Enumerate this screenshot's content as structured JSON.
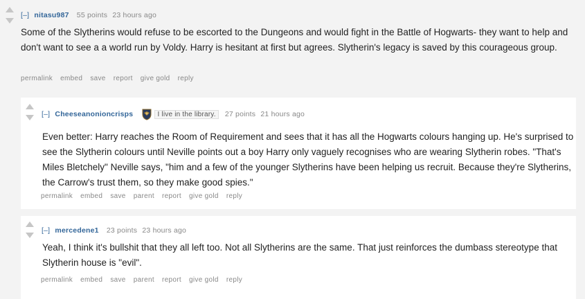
{
  "comments": [
    {
      "toggle": "[–]",
      "author": "nitasu987",
      "score": "55 points",
      "time": "23 hours ago",
      "body": "Some of the Slytherins would refuse to be escorted to the Dungeons and would fight in the Battle of Hogwarts- they want to help and don't want to see a a world run by Voldy. Harry is hesitant at first but agrees. Slytherin's legacy is saved by this courageous group.",
      "buttons": [
        "permalink",
        "embed",
        "save",
        "report",
        "give gold",
        "reply"
      ]
    },
    {
      "toggle": "[–]",
      "author": "Cheeseanonioncrisps",
      "flair_icon": "ravenclaw-crest-icon",
      "flair_text": "I live in the library.",
      "score": "27 points",
      "time": "21 hours ago",
      "body": "Even better: Harry reaches the Room of Requirement and sees that it has all the Hogwarts colours hanging up. He's surprised to see the Slytherin colours until Neville points out a boy Harry only vaguely recognises who are wearing Slytherin robes. \"That's Miles Bletchely\" Neville says, \"him and a few of the younger Slytherins have been helping us recruit. Because they're Slytherins, the Carrow's trust them, so they make good spies.\"",
      "buttons": [
        "permalink",
        "embed",
        "save",
        "parent",
        "report",
        "give gold",
        "reply"
      ]
    },
    {
      "toggle": "[–]",
      "author": "mercedene1",
      "score": "23 points",
      "time": "23 hours ago",
      "body": "Yeah, I think it's bullshit that they all left too. Not all Slytherins are the same. That just reinforces the dumbass stereotype that Slytherin house is \"evil\".",
      "buttons": [
        "permalink",
        "embed",
        "save",
        "parent",
        "report",
        "give gold",
        "reply"
      ]
    }
  ],
  "colors": {
    "author": "#336699",
    "meta": "#888888",
    "arrow": "#c6c6c6",
    "body": "#222222"
  }
}
